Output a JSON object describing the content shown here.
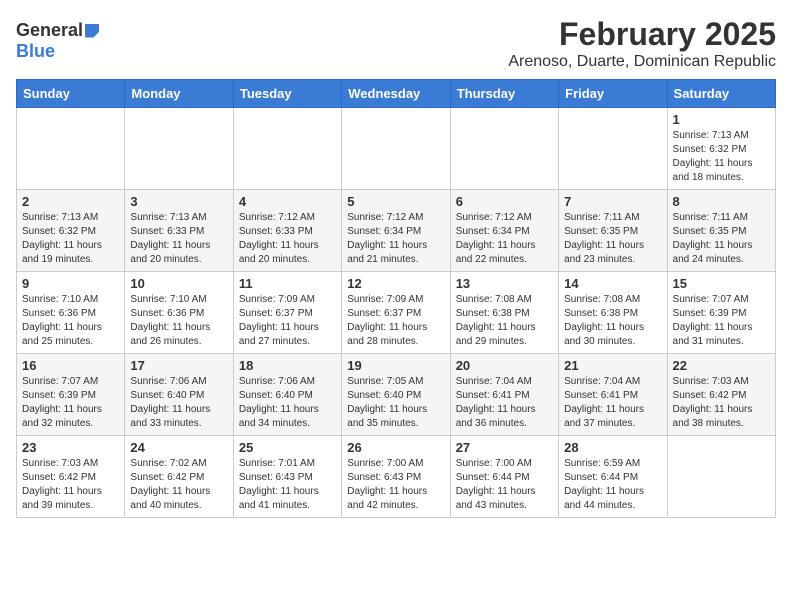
{
  "header": {
    "logo_general": "General",
    "logo_blue": "Blue",
    "title": "February 2025",
    "subtitle": "Arenoso, Duarte, Dominican Republic"
  },
  "calendar": {
    "days_of_week": [
      "Sunday",
      "Monday",
      "Tuesday",
      "Wednesday",
      "Thursday",
      "Friday",
      "Saturday"
    ],
    "weeks": [
      [
        {
          "day": "",
          "info": ""
        },
        {
          "day": "",
          "info": ""
        },
        {
          "day": "",
          "info": ""
        },
        {
          "day": "",
          "info": ""
        },
        {
          "day": "",
          "info": ""
        },
        {
          "day": "",
          "info": ""
        },
        {
          "day": "1",
          "info": "Sunrise: 7:13 AM\nSunset: 6:32 PM\nDaylight: 11 hours and 18 minutes."
        }
      ],
      [
        {
          "day": "2",
          "info": "Sunrise: 7:13 AM\nSunset: 6:32 PM\nDaylight: 11 hours and 19 minutes."
        },
        {
          "day": "3",
          "info": "Sunrise: 7:13 AM\nSunset: 6:33 PM\nDaylight: 11 hours and 20 minutes."
        },
        {
          "day": "4",
          "info": "Sunrise: 7:12 AM\nSunset: 6:33 PM\nDaylight: 11 hours and 20 minutes."
        },
        {
          "day": "5",
          "info": "Sunrise: 7:12 AM\nSunset: 6:34 PM\nDaylight: 11 hours and 21 minutes."
        },
        {
          "day": "6",
          "info": "Sunrise: 7:12 AM\nSunset: 6:34 PM\nDaylight: 11 hours and 22 minutes."
        },
        {
          "day": "7",
          "info": "Sunrise: 7:11 AM\nSunset: 6:35 PM\nDaylight: 11 hours and 23 minutes."
        },
        {
          "day": "8",
          "info": "Sunrise: 7:11 AM\nSunset: 6:35 PM\nDaylight: 11 hours and 24 minutes."
        }
      ],
      [
        {
          "day": "9",
          "info": "Sunrise: 7:10 AM\nSunset: 6:36 PM\nDaylight: 11 hours and 25 minutes."
        },
        {
          "day": "10",
          "info": "Sunrise: 7:10 AM\nSunset: 6:36 PM\nDaylight: 11 hours and 26 minutes."
        },
        {
          "day": "11",
          "info": "Sunrise: 7:09 AM\nSunset: 6:37 PM\nDaylight: 11 hours and 27 minutes."
        },
        {
          "day": "12",
          "info": "Sunrise: 7:09 AM\nSunset: 6:37 PM\nDaylight: 11 hours and 28 minutes."
        },
        {
          "day": "13",
          "info": "Sunrise: 7:08 AM\nSunset: 6:38 PM\nDaylight: 11 hours and 29 minutes."
        },
        {
          "day": "14",
          "info": "Sunrise: 7:08 AM\nSunset: 6:38 PM\nDaylight: 11 hours and 30 minutes."
        },
        {
          "day": "15",
          "info": "Sunrise: 7:07 AM\nSunset: 6:39 PM\nDaylight: 11 hours and 31 minutes."
        }
      ],
      [
        {
          "day": "16",
          "info": "Sunrise: 7:07 AM\nSunset: 6:39 PM\nDaylight: 11 hours and 32 minutes."
        },
        {
          "day": "17",
          "info": "Sunrise: 7:06 AM\nSunset: 6:40 PM\nDaylight: 11 hours and 33 minutes."
        },
        {
          "day": "18",
          "info": "Sunrise: 7:06 AM\nSunset: 6:40 PM\nDaylight: 11 hours and 34 minutes."
        },
        {
          "day": "19",
          "info": "Sunrise: 7:05 AM\nSunset: 6:40 PM\nDaylight: 11 hours and 35 minutes."
        },
        {
          "day": "20",
          "info": "Sunrise: 7:04 AM\nSunset: 6:41 PM\nDaylight: 11 hours and 36 minutes."
        },
        {
          "day": "21",
          "info": "Sunrise: 7:04 AM\nSunset: 6:41 PM\nDaylight: 11 hours and 37 minutes."
        },
        {
          "day": "22",
          "info": "Sunrise: 7:03 AM\nSunset: 6:42 PM\nDaylight: 11 hours and 38 minutes."
        }
      ],
      [
        {
          "day": "23",
          "info": "Sunrise: 7:03 AM\nSunset: 6:42 PM\nDaylight: 11 hours and 39 minutes."
        },
        {
          "day": "24",
          "info": "Sunrise: 7:02 AM\nSunset: 6:42 PM\nDaylight: 11 hours and 40 minutes."
        },
        {
          "day": "25",
          "info": "Sunrise: 7:01 AM\nSunset: 6:43 PM\nDaylight: 11 hours and 41 minutes."
        },
        {
          "day": "26",
          "info": "Sunrise: 7:00 AM\nSunset: 6:43 PM\nDaylight: 11 hours and 42 minutes."
        },
        {
          "day": "27",
          "info": "Sunrise: 7:00 AM\nSunset: 6:44 PM\nDaylight: 11 hours and 43 minutes."
        },
        {
          "day": "28",
          "info": "Sunrise: 6:59 AM\nSunset: 6:44 PM\nDaylight: 11 hours and 44 minutes."
        },
        {
          "day": "",
          "info": ""
        }
      ]
    ]
  }
}
